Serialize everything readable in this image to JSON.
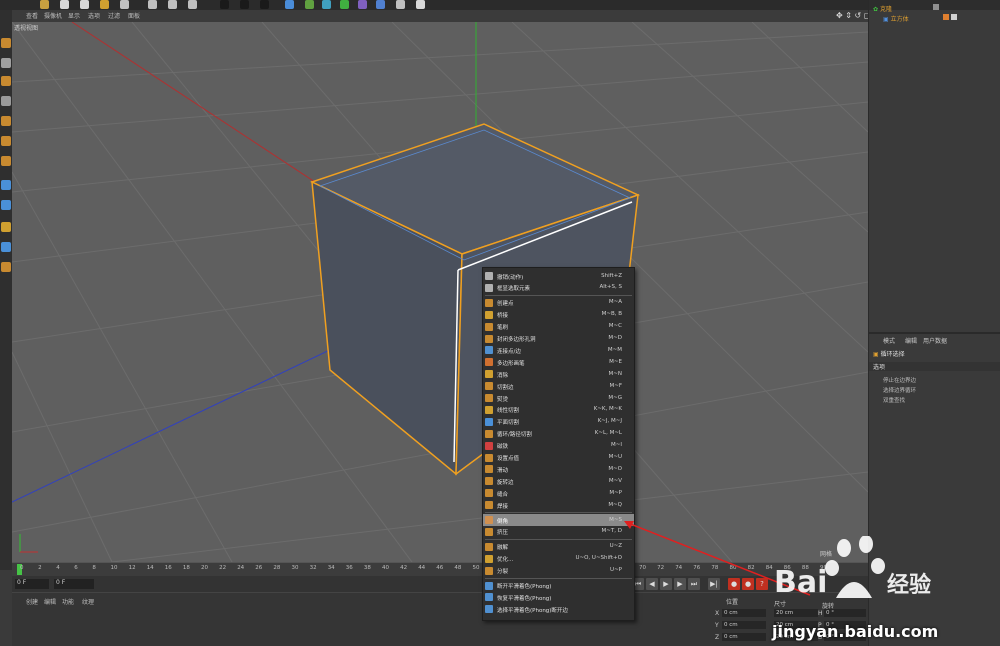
{
  "viewport": {
    "label": "透视视图",
    "menu": [
      "查看",
      "摄像机",
      "显示",
      "选项",
      "过滤",
      "面板"
    ]
  },
  "object_manager": {
    "items": [
      {
        "label": "克隆"
      },
      {
        "label": "立方体"
      }
    ]
  },
  "attributes": {
    "tabs": [
      "模式",
      "编辑",
      "用户数据"
    ],
    "title": "循环选择",
    "section": "选项",
    "options": [
      "停止在边界边",
      "选择边界循环",
      "双重查找"
    ]
  },
  "timeline": {
    "ticks": [
      "0",
      "2",
      "4",
      "6",
      "8",
      "10",
      "12",
      "14",
      "16",
      "18",
      "20",
      "22",
      "24",
      "26",
      "28",
      "30",
      "32",
      "34",
      "36",
      "38",
      "40",
      "42",
      "44",
      "46",
      "48",
      "50",
      "70",
      "72",
      "74",
      "76",
      "78",
      "80",
      "82",
      "84",
      "86",
      "88",
      "90"
    ],
    "frame_current": "0 F",
    "frame_range": "0 F"
  },
  "material_bar": {
    "menu": [
      "创建",
      "编辑",
      "功能",
      "纹理"
    ]
  },
  "coordinates": {
    "headers": [
      "位置",
      "尺寸",
      "旋转"
    ],
    "rows": [
      {
        "axis": "X",
        "pos": "0 cm",
        "size": "20 cm",
        "rot_axis": "H",
        "rot": "0 °"
      },
      {
        "axis": "Y",
        "pos": "0 cm",
        "size": "20 cm",
        "rot_axis": "P",
        "rot": "0 °"
      },
      {
        "axis": "Z",
        "pos": "0 cm",
        "size": "20 cm",
        "rot_axis": "B",
        "rot": "0 °"
      }
    ],
    "mode_label": "网格"
  },
  "context_menu": {
    "items": [
      {
        "label": "撤销(动作)",
        "shortcut": "Shift+Z"
      },
      {
        "label": "框显选取元素",
        "shortcut": "Alt+S, S"
      },
      {
        "label": "创建点",
        "shortcut": "M~A"
      },
      {
        "label": "桥接",
        "shortcut": "M~B, B"
      },
      {
        "label": "笔刷",
        "shortcut": "M~C"
      },
      {
        "label": "封闭多边形孔洞",
        "shortcut": "M~D"
      },
      {
        "label": "连接点/边",
        "shortcut": "M~M"
      },
      {
        "label": "多边形画笔",
        "shortcut": "M~E"
      },
      {
        "label": "消除",
        "shortcut": "M~N"
      },
      {
        "label": "切割边",
        "shortcut": "M~F"
      },
      {
        "label": "熨烫",
        "shortcut": "M~G"
      },
      {
        "label": "线性切割",
        "shortcut": "K~K, M~K"
      },
      {
        "label": "平面切割",
        "shortcut": "K~J, M~J"
      },
      {
        "label": "循环/路径切割",
        "shortcut": "K~L, M~L"
      },
      {
        "label": "磁铁",
        "shortcut": "M~I"
      },
      {
        "label": "设置点值",
        "shortcut": "M~U"
      },
      {
        "label": "滑动",
        "shortcut": "M~O"
      },
      {
        "label": "旋转边",
        "shortcut": "M~V"
      },
      {
        "label": "缝合",
        "shortcut": "M~P"
      },
      {
        "label": "焊接",
        "shortcut": "M~Q"
      },
      {
        "label": "倒角",
        "shortcut": "M~S"
      },
      {
        "label": "挤压",
        "shortcut": "M~T, D"
      },
      {
        "label": "融解",
        "shortcut": "U~Z"
      },
      {
        "label": "优化...",
        "shortcut": "U~O, U~Shift+O"
      },
      {
        "label": "分裂",
        "shortcut": "U~P"
      },
      {
        "label": "断开平滑着色(Phong)",
        "shortcut": ""
      },
      {
        "label": "恢复平滑着色(Phong)",
        "shortcut": ""
      },
      {
        "label": "选择平滑着色(Phong)断开边",
        "shortcut": ""
      }
    ],
    "highlighted": "倒角"
  },
  "watermark": {
    "url": "jingyan.baidu.com"
  },
  "colors": {
    "selection": "#f0a020",
    "menu_highlight": "#8a8a8a",
    "axis_x": "#c03030",
    "axis_y": "#30c030",
    "axis_z": "#3040c0"
  }
}
